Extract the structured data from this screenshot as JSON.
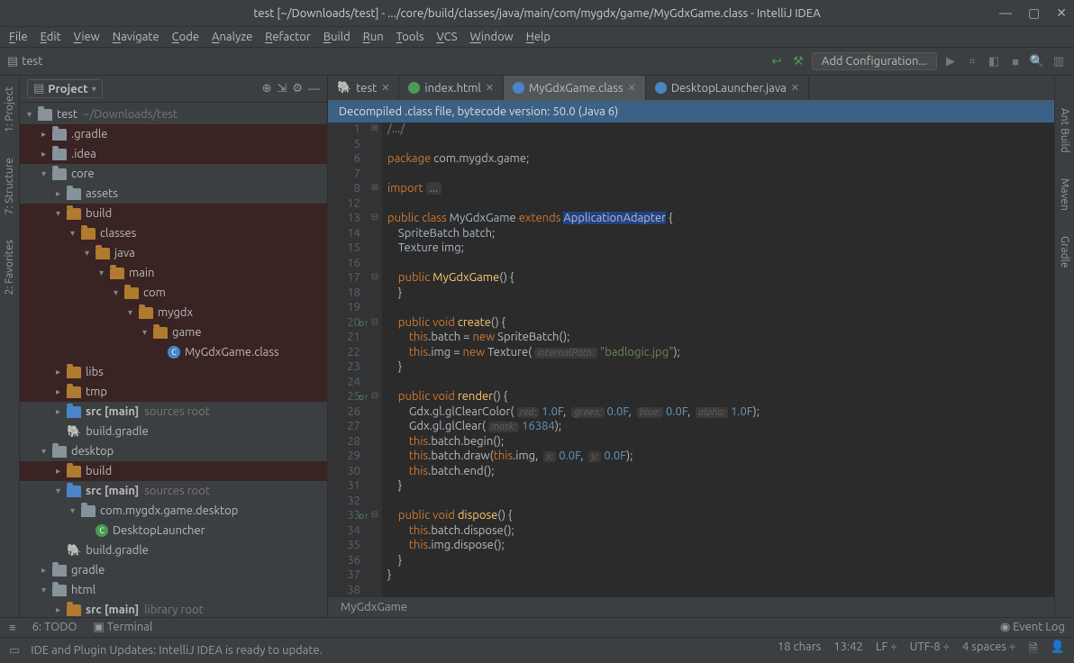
{
  "window": {
    "title": "test [~/Downloads/test] - .../core/build/classes/java/main/com/mygdx/game/MyGdxGame.class - IntelliJ IDEA"
  },
  "menu": [
    "File",
    "Edit",
    "View",
    "Navigate",
    "Code",
    "Analyze",
    "Refactor",
    "Build",
    "Run",
    "Tools",
    "VCS",
    "Window",
    "Help"
  ],
  "toolbar": {
    "breadcrumb_project": "test",
    "add_config": "Add Configuration..."
  },
  "right_rail": [
    "Ant Build",
    "Maven",
    "Gradle"
  ],
  "left_rail": [
    "1: Project",
    "7: Structure",
    "2: Favorites"
  ],
  "project_panel": {
    "title": "Project",
    "tree": [
      {
        "d": 0,
        "a": "▾",
        "i": "fld",
        "lbl": "test",
        "dim": "~/Downloads/test"
      },
      {
        "d": 1,
        "a": "▸",
        "i": "fld",
        "cls": "exc",
        "lbl": ".gradle"
      },
      {
        "d": 1,
        "a": "▸",
        "i": "fld",
        "cls": "exc",
        "lbl": ".idea"
      },
      {
        "d": 1,
        "a": "▾",
        "i": "fld",
        "lbl": "core"
      },
      {
        "d": 2,
        "a": "▸",
        "i": "fld",
        "lbl": "assets"
      },
      {
        "d": 2,
        "a": "▾",
        "i": "fld orange",
        "cls": "exc",
        "lbl": "build"
      },
      {
        "d": 3,
        "a": "▾",
        "i": "fld orange",
        "cls": "exc",
        "lbl": "classes"
      },
      {
        "d": 4,
        "a": "▾",
        "i": "fld orange",
        "cls": "exc",
        "lbl": "java"
      },
      {
        "d": 5,
        "a": "▾",
        "i": "fld orange",
        "cls": "exc",
        "lbl": "main"
      },
      {
        "d": 6,
        "a": "▾",
        "i": "fld orange",
        "cls": "exc",
        "lbl": "com"
      },
      {
        "d": 7,
        "a": "▾",
        "i": "fld orange",
        "cls": "exc",
        "lbl": "mygdx"
      },
      {
        "d": 8,
        "a": "▾",
        "i": "fld orange",
        "cls": "exc",
        "lbl": "game"
      },
      {
        "d": 9,
        "a": "",
        "i": "cls",
        "cls": "exc",
        "lbl": "MyGdxGame.class"
      },
      {
        "d": 2,
        "a": "▸",
        "i": "fld orange",
        "cls": "exc",
        "lbl": "libs"
      },
      {
        "d": 2,
        "a": "▸",
        "i": "fld orange",
        "cls": "exc",
        "lbl": "tmp"
      },
      {
        "d": 2,
        "a": "▸",
        "i": "fld blue",
        "lbl": "src [main]",
        "dim": "sources root",
        "bold": true
      },
      {
        "d": 2,
        "a": "",
        "i": "gradle",
        "lbl": "build.gradle"
      },
      {
        "d": 1,
        "a": "▾",
        "i": "fld",
        "lbl": "desktop"
      },
      {
        "d": 2,
        "a": "▸",
        "i": "fld orange",
        "cls": "exc",
        "lbl": "build"
      },
      {
        "d": 2,
        "a": "▾",
        "i": "fld blue",
        "lbl": "src [main]",
        "dim": "sources root",
        "bold": true
      },
      {
        "d": 3,
        "a": "▾",
        "i": "fld",
        "lbl": "com.mygdx.game.desktop"
      },
      {
        "d": 4,
        "a": "",
        "i": "c-green",
        "lbl": "DesktopLauncher"
      },
      {
        "d": 2,
        "a": "",
        "i": "gradle",
        "lbl": "build.gradle"
      },
      {
        "d": 1,
        "a": "▸",
        "i": "fld",
        "lbl": "gradle"
      },
      {
        "d": 1,
        "a": "▾",
        "i": "fld",
        "lbl": "html"
      },
      {
        "d": 2,
        "a": "▸",
        "i": "fld orange",
        "lbl": "src [main]",
        "dim": "library root",
        "bold": true
      }
    ]
  },
  "tabs": [
    {
      "label": "test",
      "icon": "elephant"
    },
    {
      "label": "index.html",
      "icon": "html"
    },
    {
      "label": "MyGdxGame.class",
      "icon": "cls",
      "active": true
    },
    {
      "label": "DesktopLauncher.java",
      "icon": "java"
    }
  ],
  "banner": "Decompiled .class file, bytecode version: 50.0 (Java 6)",
  "gutter": [
    "1",
    "5",
    "6",
    "7",
    "8",
    "12",
    "13",
    "14",
    "15",
    "16",
    "17",
    "18",
    "19",
    "20",
    "21",
    "22",
    "23",
    "24",
    "25",
    "26",
    "27",
    "28",
    "29",
    "30",
    "31",
    "32",
    "33",
    "34",
    "35",
    "36",
    "37",
    "38",
    ""
  ],
  "override_lines": [
    20,
    25,
    33
  ],
  "code_breadcrumb": "MyGdxGame",
  "bottom": {
    "todo": "6: TODO",
    "terminal": "Terminal",
    "eventlog": "Event Log"
  },
  "status": {
    "msg": "IDE and Plugin Updates: IntelliJ IDEA is ready to update.",
    "chars": "18 chars",
    "time": "13:42",
    "le": "LF",
    "enc": "UTF-8",
    "ind": "4 spaces"
  }
}
